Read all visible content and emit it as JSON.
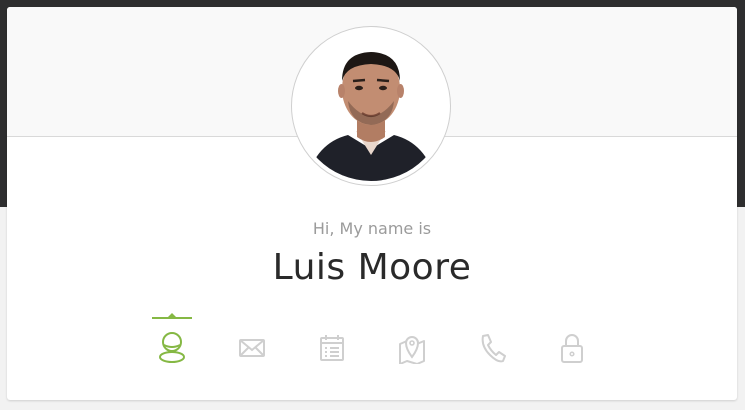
{
  "profile": {
    "greeting": "Hi, My name is",
    "name": "Luis Moore"
  },
  "icons": [
    {
      "name": "user-icon",
      "active": true
    },
    {
      "name": "email-icon",
      "active": false
    },
    {
      "name": "calendar-icon",
      "active": false
    },
    {
      "name": "map-icon",
      "active": false
    },
    {
      "name": "phone-icon",
      "active": false
    },
    {
      "name": "lock-icon",
      "active": false
    }
  ],
  "colors": {
    "accent": "#85b844",
    "icon_inactive": "#cfcfcf",
    "name_text": "#2a2a2a",
    "greeting_text": "#9b9b9b",
    "top_background": "#2e2e2f"
  }
}
